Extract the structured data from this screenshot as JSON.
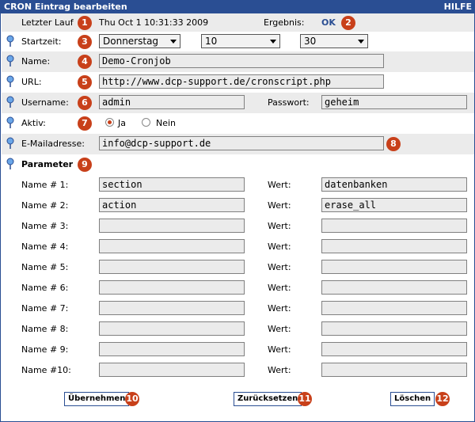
{
  "title": "CRON Eintrag bearbeiten",
  "help": "HILFE",
  "status": {
    "last_run_label": "Letzter Lauf",
    "last_run_value": "Thu Oct 1 10:31:33 2009",
    "result_label": "Ergebnis:",
    "result_value": "OK"
  },
  "startzeit": {
    "label": "Startzeit:",
    "day": "Donnerstag",
    "hour": "10",
    "minute": "30"
  },
  "name": {
    "label": "Name:",
    "value": "Demo-Cronjob"
  },
  "url": {
    "label": "URL:",
    "value": "http://www.dcp-support.de/cronscript.php"
  },
  "username": {
    "label": "Username:",
    "value": "admin"
  },
  "passwort": {
    "label": "Passwort:",
    "value": "geheim"
  },
  "aktiv": {
    "label": "Aktiv:",
    "yes": "Ja",
    "no": "Nein",
    "selected": "Ja"
  },
  "email": {
    "label": "E-Mailadresse:",
    "value": "info@dcp-support.de"
  },
  "parameter_heading": "Parameter",
  "wert_label": "Wert:",
  "params": [
    {
      "label": "Name # 1:",
      "name": "section",
      "wert": "datenbanken"
    },
    {
      "label": "Name # 2:",
      "name": "action",
      "wert": "erase_all"
    },
    {
      "label": "Name # 3:",
      "name": "",
      "wert": ""
    },
    {
      "label": "Name # 4:",
      "name": "",
      "wert": ""
    },
    {
      "label": "Name # 5:",
      "name": "",
      "wert": ""
    },
    {
      "label": "Name # 6:",
      "name": "",
      "wert": ""
    },
    {
      "label": "Name # 7:",
      "name": "",
      "wert": ""
    },
    {
      "label": "Name # 8:",
      "name": "",
      "wert": ""
    },
    {
      "label": "Name # 9:",
      "name": "",
      "wert": ""
    },
    {
      "label": "Name #10:",
      "name": "",
      "wert": ""
    }
  ],
  "buttons": {
    "save": "Übernehmen",
    "reset": "Zurücksetzen",
    "delete": "Löschen"
  },
  "badges": [
    "1",
    "2",
    "3",
    "4",
    "5",
    "6",
    "7",
    "8",
    "9",
    "10",
    "11",
    "12"
  ],
  "colors": {
    "header": "#2a4e93",
    "badge": "#c8401a",
    "row_gray": "#ebebeb"
  }
}
